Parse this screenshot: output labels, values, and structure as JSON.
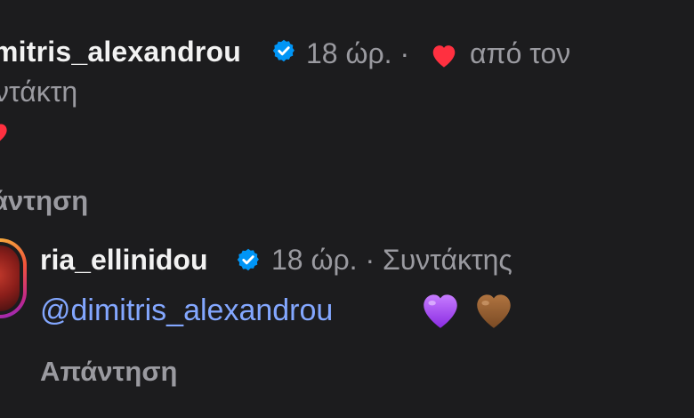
{
  "parent": {
    "username": "mitris_alexandrou",
    "time": "18 ώρ. ·",
    "liked_by": "από τον",
    "liked_by_line2": "ντάκτη",
    "reply_label": "άντηση",
    "verified_icon": "verified-badge-icon",
    "heart_icon": "heart-icon",
    "heart_color": "#ff3040"
  },
  "child": {
    "username": "ria_ellinidou",
    "time": "18 ώρ. · Συντάκτης",
    "mention": "@dimitris_alexandrou",
    "reply_label": "Απάντηση",
    "emojis": [
      "purple-heart-icon",
      "brown-heart-icon"
    ],
    "mention_color": "#83a7ff"
  },
  "colors": {
    "background": "#1c1c1e",
    "verified": "#0095f6",
    "secondary_text": "#9a9aa0",
    "primary_text": "#f2f2f2"
  }
}
